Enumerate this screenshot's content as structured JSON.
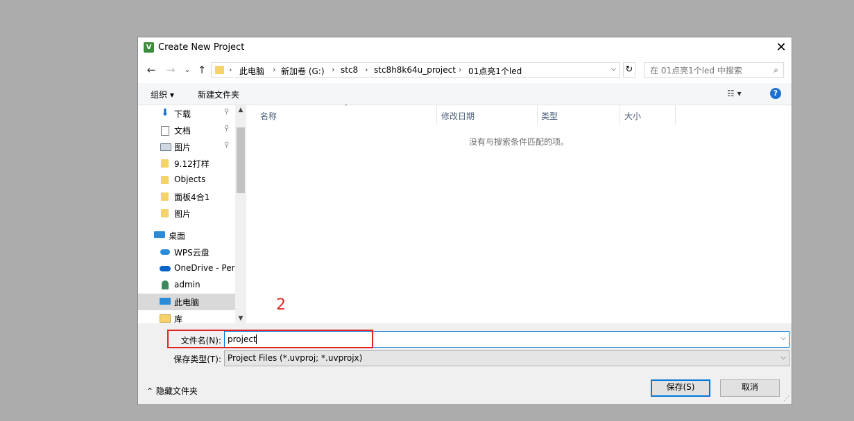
{
  "window": {
    "title": "Create New Project",
    "close_glyph": "✕"
  },
  "nav": {
    "back_glyph": "←",
    "forward_glyph": "→",
    "recent_glyph": "⌄",
    "up_glyph": "↑",
    "breadcrumbs": [
      "此电脑",
      "新加卷 (G:)",
      "stc8",
      "stc8h8k64u_project",
      "01点亮1个led"
    ],
    "breadcrumb_sep": "›",
    "addr_dropdown_glyph": "⌵",
    "refresh_glyph": "↻",
    "search_placeholder": "在 01点亮1个led 中搜索"
  },
  "toolbar": {
    "organize": "组织 ▾",
    "new_folder": "新建文件夹",
    "view_glyph": "☷ ▾",
    "help_glyph": "?"
  },
  "sidebar": {
    "items": [
      {
        "label": "下载",
        "icon": "download-icon",
        "pinned": true
      },
      {
        "label": "文档",
        "icon": "document-icon",
        "pinned": true
      },
      {
        "label": "图片",
        "icon": "pictures-icon",
        "pinned": true
      },
      {
        "label": "9.12打样",
        "icon": "folder-icon"
      },
      {
        "label": "Objects",
        "icon": "folder-icon"
      },
      {
        "label": "面板4合1",
        "icon": "folder-icon"
      },
      {
        "label": "图片",
        "icon": "folder-icon"
      },
      {
        "label": "桌面",
        "icon": "desktop-icon"
      },
      {
        "label": "WPS云盘",
        "icon": "cloud-icon"
      },
      {
        "label": "OneDrive - Per",
        "icon": "onedrive-icon"
      },
      {
        "label": "admin",
        "icon": "user-icon"
      },
      {
        "label": "此电脑",
        "icon": "computer-icon",
        "selected": true
      },
      {
        "label": "库",
        "icon": "library-icon"
      }
    ],
    "pin_glyph": "📌"
  },
  "columns": [
    "名称",
    "修改日期",
    "类型",
    "大小"
  ],
  "empty_message": "没有与搜索条件匹配的项。",
  "annotation": "2",
  "form": {
    "filename_label": "文件名(N):",
    "filename_value": "project",
    "filetype_label": "保存类型(T):",
    "filetype_value": "Project Files (*.uvproj; *.uvprojx)"
  },
  "footer": {
    "hide_folders": "⌃ 隐藏文件夹",
    "save": "保存(S)",
    "cancel": "取消"
  },
  "colors": {
    "accent": "#0078d7",
    "annotation_red": "#e02424",
    "selected_bg": "#d9d9d9"
  }
}
